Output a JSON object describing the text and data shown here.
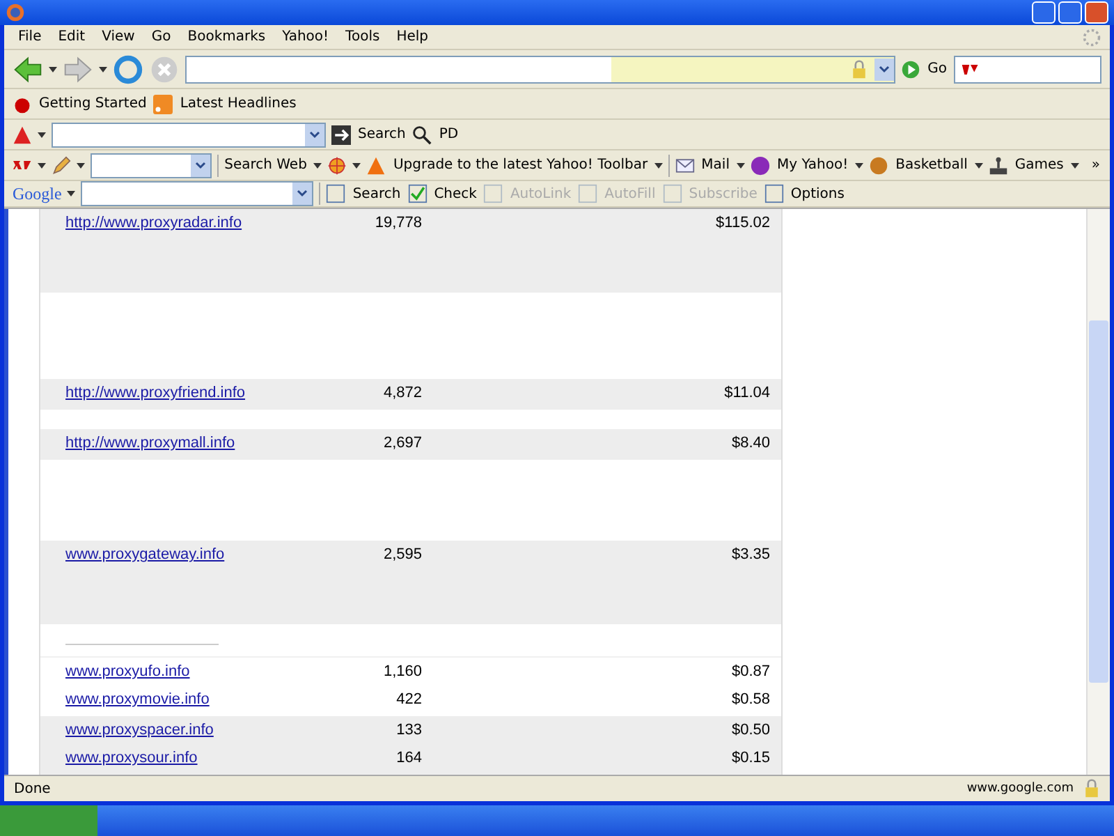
{
  "menu": [
    "File",
    "Edit",
    "View",
    "Go",
    "Bookmarks",
    "Yahoo!",
    "Tools",
    "Help"
  ],
  "nav": {
    "go": "Go"
  },
  "bookmarks": [
    "Getting Started",
    "Latest Headlines"
  ],
  "a_toolbar": {
    "search": "Search",
    "extra": "PD"
  },
  "yahoo_toolbar": {
    "items": [
      {
        "label": "Search Web",
        "kind": "menu"
      },
      {
        "label": "Upgrade to the latest Yahoo! Toolbar",
        "kind": "alert"
      },
      {
        "label": "Mail",
        "kind": "mail"
      },
      {
        "label": "My Yahoo!",
        "kind": "my"
      },
      {
        "label": "Basketball",
        "kind": "ball"
      },
      {
        "label": "Games",
        "kind": "games"
      }
    ],
    "more": "»"
  },
  "google_toolbar": {
    "logo": "Google",
    "items": [
      {
        "label": "Search",
        "disabled": false
      },
      {
        "label": "Check",
        "disabled": false
      },
      {
        "label": "AutoLink",
        "disabled": true
      },
      {
        "label": "AutoFill",
        "disabled": true
      },
      {
        "label": "Subscribe",
        "disabled": true
      },
      {
        "label": "Options",
        "disabled": false
      }
    ]
  },
  "groups": [
    {
      "shaded": true,
      "rows": [
        {
          "url": "http://www.proxyradar.info",
          "count": "19,778",
          "price": "$115.02"
        }
      ]
    },
    {
      "shaded": true,
      "rows": [
        {
          "url": "http://www.proxyfriend.info",
          "count": "4,872",
          "price": "$11.04"
        }
      ]
    },
    {
      "shaded": true,
      "rows": [
        {
          "url": "http://www.proxymall.info",
          "count": "2,697",
          "price": "$8.40"
        }
      ]
    },
    {
      "shaded": true,
      "rows": [
        {
          "url": "www.proxygateway.info",
          "count": "2,595",
          "price": "$3.35"
        }
      ]
    },
    {
      "shaded": false,
      "rows": [
        {
          "url": "www.proxyufo.info",
          "count": "1,160",
          "price": "$0.87"
        },
        {
          "url": "www.proxymovie.info",
          "count": "422",
          "price": "$0.58"
        }
      ]
    },
    {
      "shaded": true,
      "rows": [
        {
          "url": "www.proxyspacer.info",
          "count": "133",
          "price": "$0.50"
        },
        {
          "url": "www.proxysour.info",
          "count": "164",
          "price": "$0.15"
        }
      ]
    }
  ],
  "status": {
    "text": "Done",
    "host": "www.google.com"
  }
}
